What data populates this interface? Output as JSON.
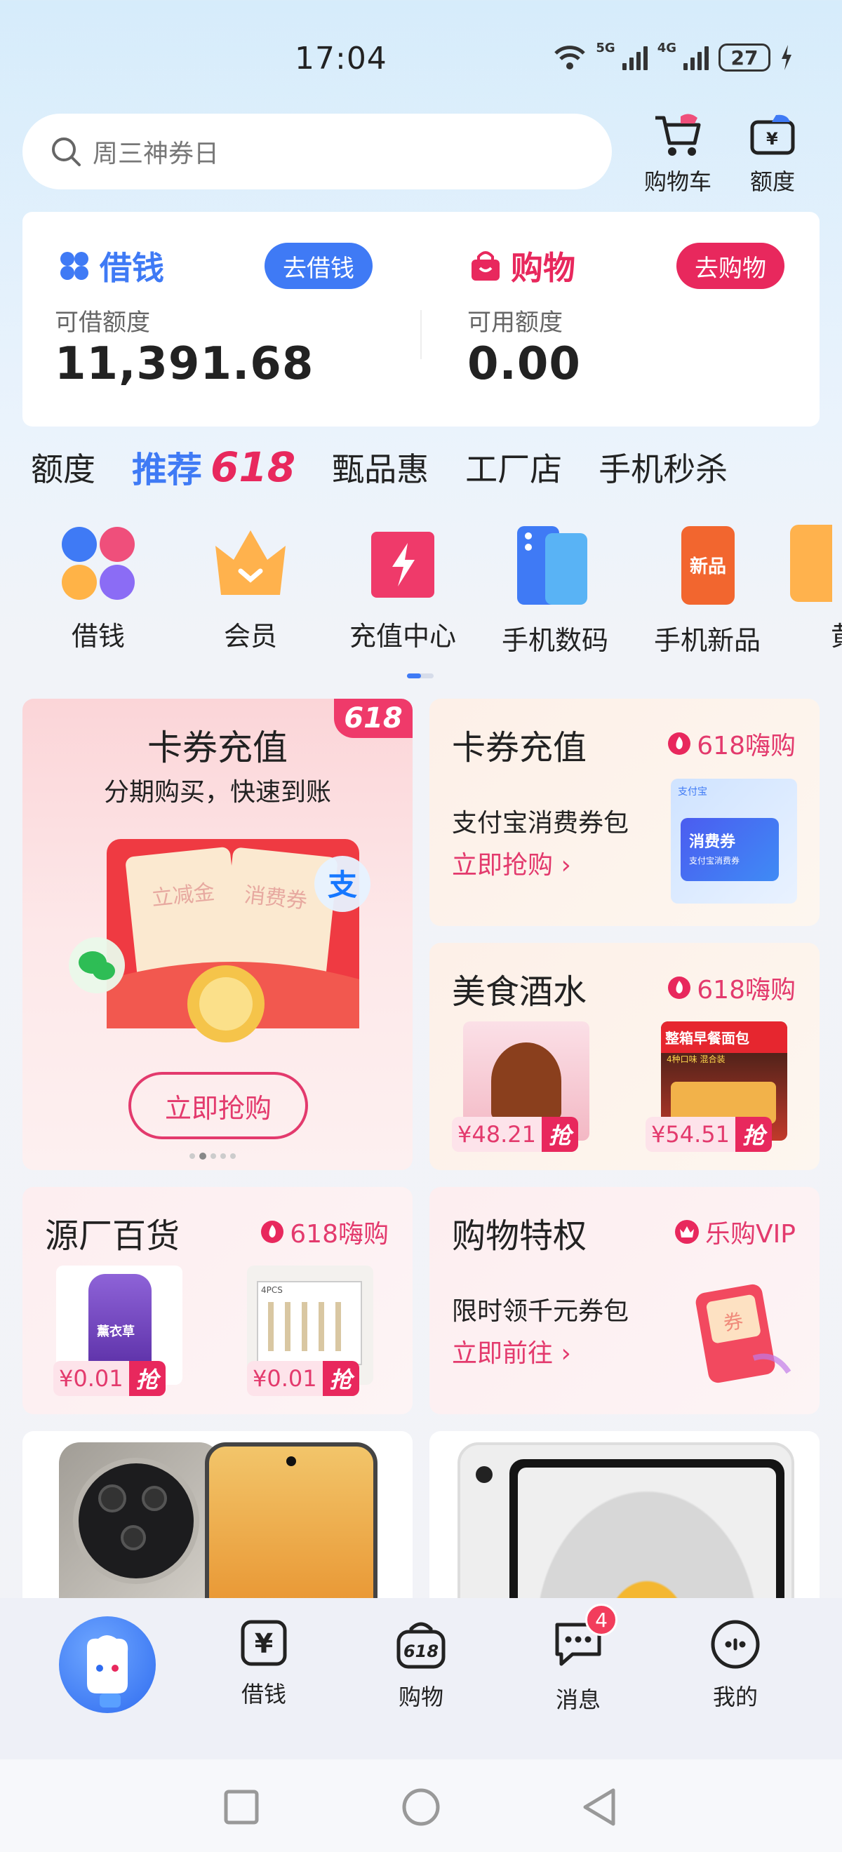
{
  "status_bar": {
    "time": "17:04",
    "net1": "5G",
    "net2": "4G",
    "battery": "27"
  },
  "search": {
    "placeholder": "周三神券日"
  },
  "top_actions": {
    "cart": "购物车",
    "quota": "额度",
    "quota_symbol": "¥"
  },
  "account": {
    "loan": {
      "title": "借钱",
      "button": "去借钱",
      "label": "可借额度",
      "value": "11,391.68"
    },
    "shop": {
      "title": "购物",
      "button": "去购物",
      "label": "可用额度",
      "value": "0.00"
    }
  },
  "tabs": [
    "额度",
    "推荐",
    "618",
    "甄品惠",
    "工厂店",
    "手机秒杀"
  ],
  "categories": [
    {
      "label": "借钱"
    },
    {
      "label": "会员"
    },
    {
      "label": "充值中心"
    },
    {
      "label": "手机数码"
    },
    {
      "label": "手机新品",
      "badge": "新品"
    },
    {
      "label": "黄"
    }
  ],
  "promo_big": {
    "title": "卡券充值",
    "subtitle": "分期购买，快速到账",
    "corner": "618",
    "coupon1": "立减金",
    "coupon2": "消费券",
    "alipay_glyph": "支",
    "button": "立即抢购"
  },
  "promo_card_recharge": {
    "title": "卡券充值",
    "tag": "618嗨购",
    "desc": "支付宝消费券包",
    "link": "立即抢购 ›",
    "img_top": "支付宝",
    "img_label": "消费券",
    "img_sub": "支付宝消费券"
  },
  "promo_food": {
    "title": "美食酒水",
    "tag": "618嗨购",
    "items": [
      {
        "price": "¥48.21",
        "grab": "抢"
      },
      {
        "price": "¥54.51",
        "grab": "抢"
      }
    ],
    "img2_title": "整箱早餐面包",
    "img2_sub": "4种口味 混合装"
  },
  "promo_factory": {
    "title": "源厂百货",
    "tag": "618嗨购",
    "items": [
      {
        "price": "¥0.01",
        "grab": "抢"
      },
      {
        "price": "¥0.01",
        "grab": "抢"
      }
    ],
    "img1_label": "薰衣草",
    "img2_label": "4PCS"
  },
  "promo_vip": {
    "title": "购物特权",
    "tag": "乐购VIP",
    "desc": "限时领千元券包",
    "link": "立即前往 ›",
    "img_label": "券"
  },
  "bottom_nav": {
    "items": [
      {
        "label": "借钱"
      },
      {
        "label": "购物"
      },
      {
        "label": "消息",
        "badge": "4"
      },
      {
        "label": "我的"
      }
    ],
    "loan_icon_glyph": "¥",
    "shop_icon_text": "618"
  }
}
